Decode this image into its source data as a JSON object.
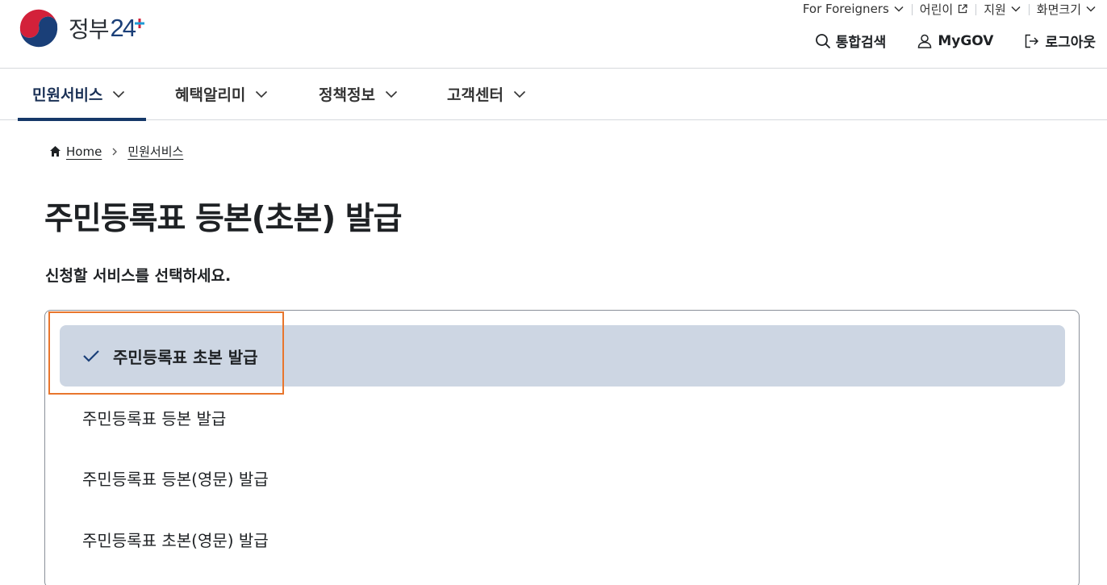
{
  "brand": {
    "name": "정부",
    "number": "24"
  },
  "util_links": [
    {
      "label": "For Foreigners",
      "icon": "chevron-down-icon"
    },
    {
      "label": "어린이",
      "icon": "external-link-icon"
    },
    {
      "label": "지원",
      "icon": "chevron-down-icon"
    },
    {
      "label": "화면크기",
      "icon": "chevron-down-icon"
    }
  ],
  "header_actions": [
    {
      "label": "통합검색",
      "icon": "search-icon"
    },
    {
      "label": "MyGOV",
      "icon": "user-icon"
    },
    {
      "label": "로그아웃",
      "icon": "logout-icon"
    }
  ],
  "nav": [
    {
      "label": "민원서비스",
      "active": true
    },
    {
      "label": "혜택알리미"
    },
    {
      "label": "정책정보"
    },
    {
      "label": "고객센터"
    }
  ],
  "breadcrumb": {
    "home": "Home",
    "current": "민원서비스"
  },
  "page": {
    "title": "주민등록표 등본(초본) 발급",
    "subtitle": "신청할 서비스를 선택하세요."
  },
  "options": [
    {
      "label": "주민등록표 초본 발급",
      "selected": true
    },
    {
      "label": "주민등록표 등본 발급"
    },
    {
      "label": "주민등록표 등본(영문) 발급"
    },
    {
      "label": "주민등록표 초본(영문) 발급"
    }
  ],
  "colors": {
    "nav_active": "#153868",
    "selected_bg": "#cdd6e3",
    "highlight_border": "#e8762d",
    "check": "#1a3f78"
  }
}
